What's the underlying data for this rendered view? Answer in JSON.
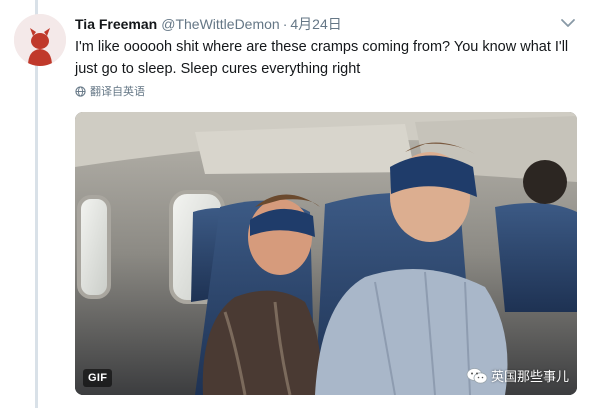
{
  "tweet": {
    "display_name": "Tia Freeman",
    "handle": "@TheWittleDemon",
    "separator": "·",
    "date": "4月24日",
    "text": "I'm like oooooh shit where are these cramps coming from? You know what I'll just go to sleep. Sleep cures everything right",
    "translate_label": "翻译自英语",
    "media_badge": "GIF"
  },
  "watermark": {
    "text": "英国那些事儿"
  },
  "colors": {
    "secondary_text": "#657786",
    "thread_line": "#d9e1e8",
    "avatar_red": "#c0392b"
  },
  "icons": [
    "avatar-devil-icon",
    "chevron-down-icon",
    "globe-icon",
    "wechat-icon"
  ]
}
